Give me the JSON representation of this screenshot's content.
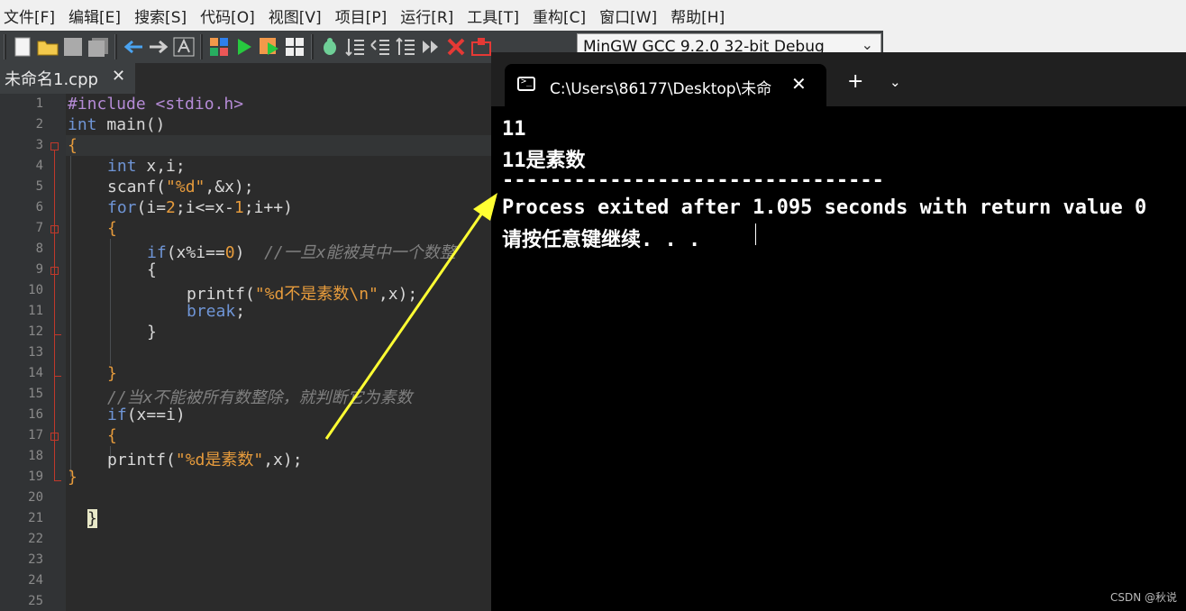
{
  "menubar": {
    "items": [
      "文件[F]",
      "编辑[E]",
      "搜索[S]",
      "代码[O]",
      "视图[V]",
      "项目[P]",
      "运行[R]",
      "工具[T]",
      "重构[C]",
      "窗口[W]",
      "帮助[H]"
    ]
  },
  "toolbar": {
    "compiler": "MinGW GCC 9.2.0 32-bit Debug",
    "icons": [
      "new-file",
      "open-file",
      "save",
      "save-all",
      "undo",
      "redo",
      "format",
      "compile",
      "run",
      "compile-run",
      "grid",
      "debug",
      "indent",
      "unindent",
      "toggle-comment",
      "step",
      "stop",
      "profile"
    ]
  },
  "editor": {
    "tab_label": "未命名1.cpp",
    "line_numbers": [
      "1",
      "2",
      "3",
      "4",
      "5",
      "6",
      "7",
      "8",
      "9",
      "10",
      "11",
      "12",
      "13",
      "14",
      "15",
      "16",
      "17",
      "18",
      "19",
      "20",
      "21",
      "22",
      "23",
      "24",
      "25"
    ],
    "lines": {
      "l1": "#include <stdio.h>",
      "l2_kw": "int",
      "l2_rest": " main()",
      "l3": "{",
      "l4_kw": "int",
      "l4_rest": " x,i;",
      "l5_a": "scanf(",
      "l5_str": "\"%d\"",
      "l5_b": ",&x);",
      "l6_kw": "for",
      "l6_a": "(i=",
      "l6_n1": "2",
      "l6_b": ";i<=x-",
      "l6_n2": "1",
      "l6_c": ";i++)",
      "l7": "{",
      "l8_kw": "if",
      "l8_a": "(x%i==",
      "l8_n": "0",
      "l8_b": ")  ",
      "l8_cmt": "//一旦x能被其中一个数整",
      "l9": "{",
      "l10_a": "printf(",
      "l10_str": "\"%d不是素数\\n\"",
      "l10_b": ",x);",
      "l11_kw": "break",
      "l11_b": ";",
      "l12": "}",
      "l14": "}",
      "l15_cmt": "//当x不能被所有数整除，就判断它为素数",
      "l16_kw": "if",
      "l16_rest": "(x==i)",
      "l17": "{",
      "l18_a": "printf(",
      "l18_str": "\"%d是素数\"",
      "l18_b": ",x);",
      "l19": "}",
      "l21": "}"
    }
  },
  "terminal": {
    "tab_title": "C:\\Users\\86177\\Desktop\\未命",
    "new_tab": "+",
    "output": [
      "11",
      "11是素数",
      "--------------------------------",
      "Process exited after 1.095 seconds with return value 0",
      "请按任意键继续. . ."
    ]
  },
  "annotation": {
    "arrow_color": "#ffff33"
  },
  "watermark": "CSDN @秋说"
}
